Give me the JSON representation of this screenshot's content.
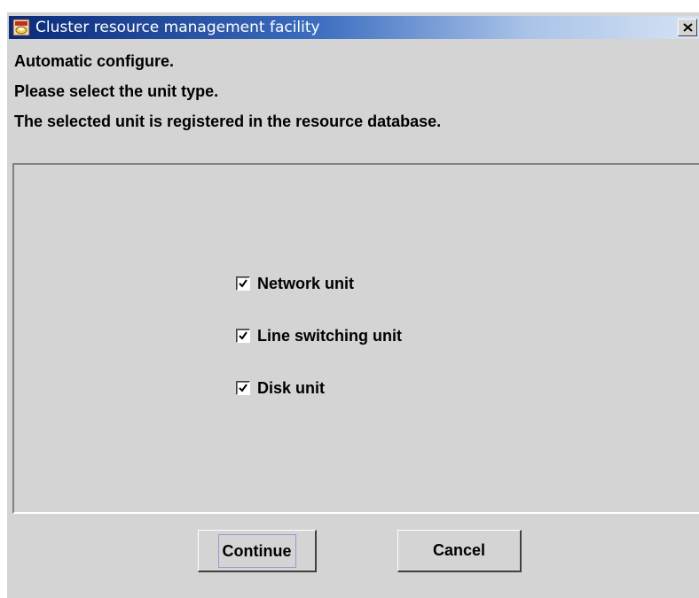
{
  "window": {
    "title": "Cluster resource management facility",
    "app_icon": "cluster-app-icon",
    "close_icon": "close-icon"
  },
  "messages": [
    "Automatic configure.",
    "Please select the unit type.",
    "The selected unit is registered in the resource database."
  ],
  "unit_types": [
    {
      "label": "Network unit",
      "checked": true
    },
    {
      "label": "Line switching unit",
      "checked": true
    },
    {
      "label": "Disk unit",
      "checked": true
    }
  ],
  "buttons": {
    "continue_label": "Continue",
    "cancel_label": "Cancel"
  },
  "colors": {
    "window_background": "#d4d4d4",
    "titlebar_start": "#0a2a7a",
    "titlebar_end": "#d6e2f3",
    "focus_outline": "#9a9ad0"
  }
}
